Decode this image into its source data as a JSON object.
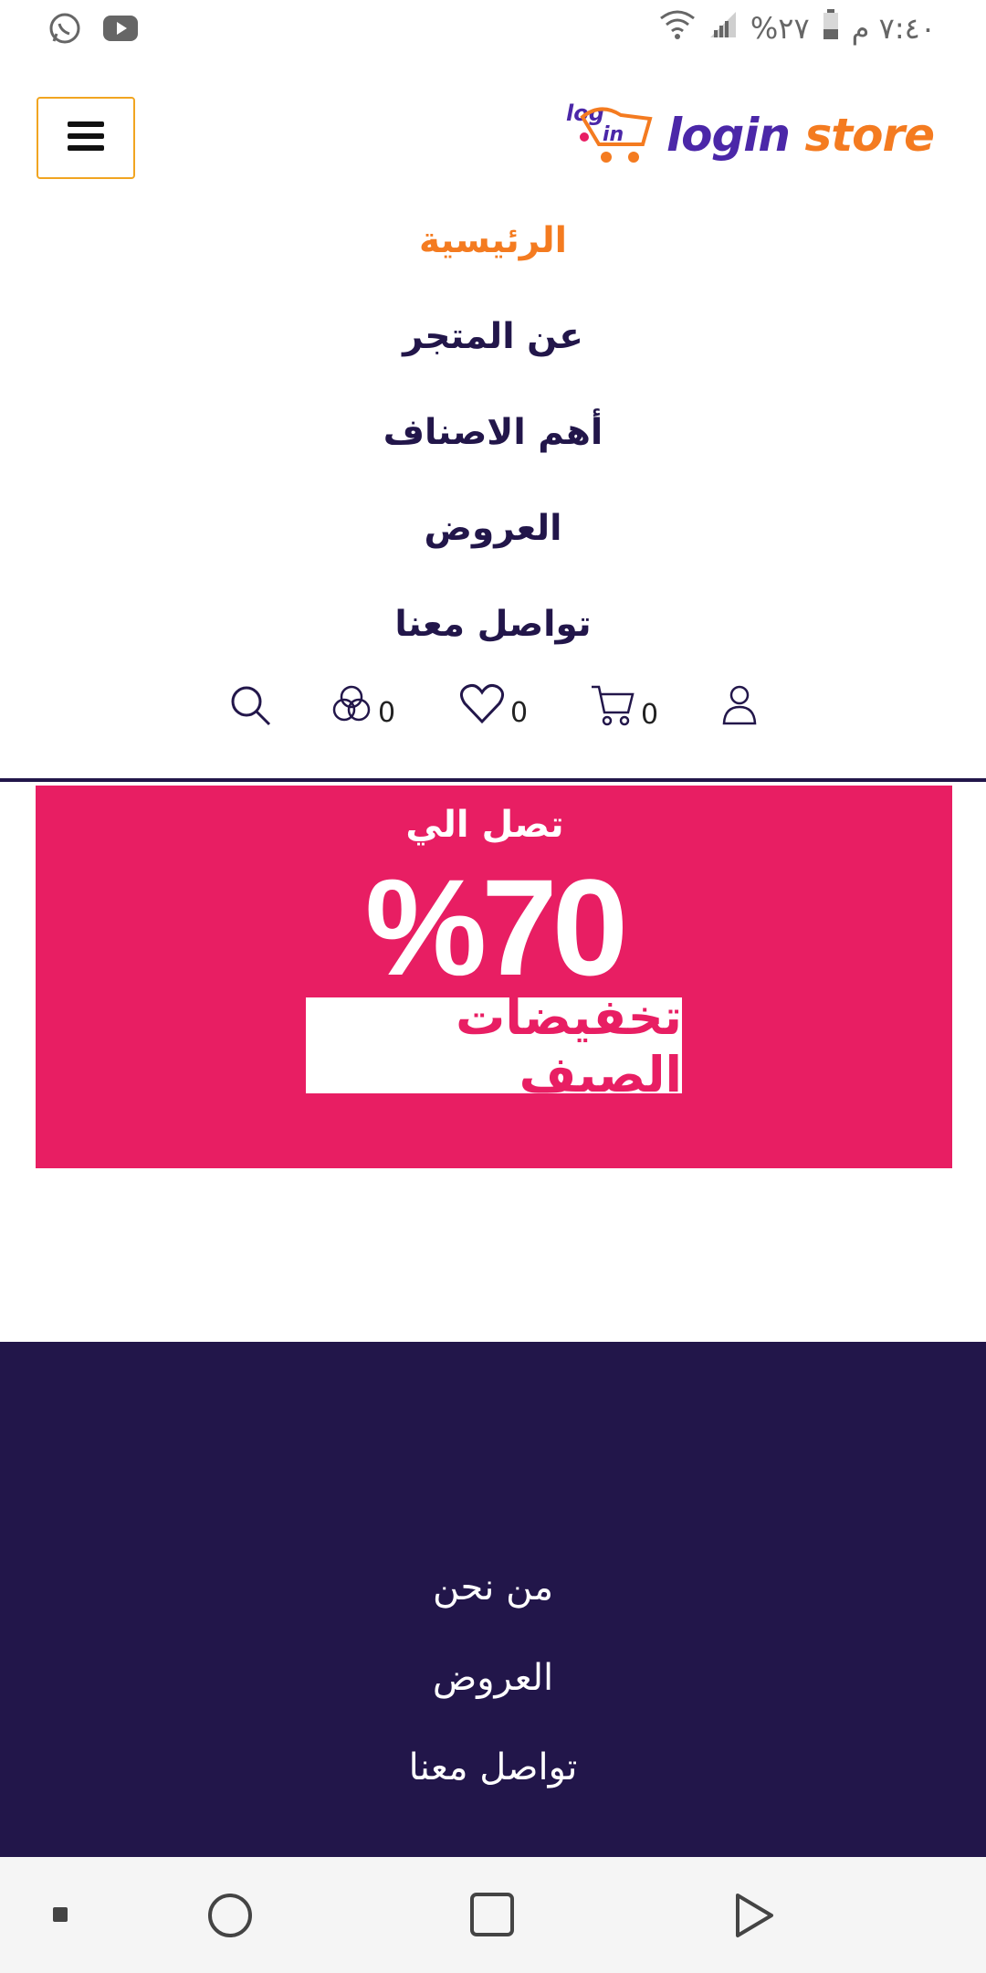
{
  "status_bar": {
    "time": "٧:٤٠ م",
    "battery": "٢٧%",
    "icons": [
      "whatsapp-icon",
      "youtube-icon",
      "wifi-icon",
      "signal-icon",
      "battery-icon"
    ]
  },
  "header": {
    "logo_login": "login",
    "logo_store": "store",
    "logo_mark_text": "log in"
  },
  "nav": {
    "items": [
      {
        "label": "الرئيسية",
        "active": true
      },
      {
        "label": "عن المتجر",
        "active": false
      },
      {
        "label": "أهم الاصناف",
        "active": false
      },
      {
        "label": "العروض",
        "active": false
      },
      {
        "label": "تواصل معنا",
        "active": false
      }
    ]
  },
  "icons_bar": {
    "compare_count": "0",
    "wishlist_count": "0",
    "cart_count": "0"
  },
  "banner": {
    "top_text": "تصل الي",
    "discount": "%70",
    "caption": "تخفيضات الصيف"
  },
  "footer": {
    "links": [
      "من نحن",
      "العروض",
      "تواصل معنا"
    ]
  },
  "colors": {
    "brand_purple": "#22164a",
    "accent_orange": "#f47b20",
    "banner_pink": "#e81e63",
    "menu_border": "#f1a521"
  }
}
